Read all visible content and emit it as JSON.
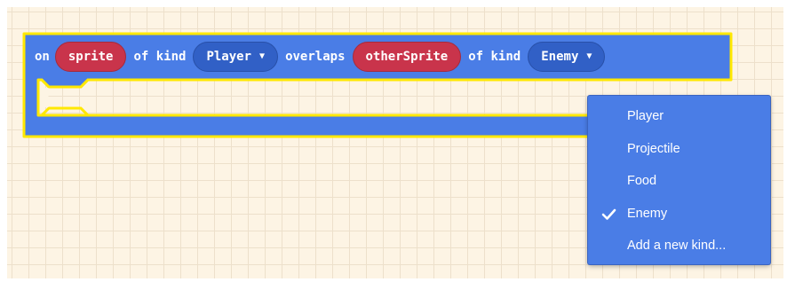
{
  "block": {
    "prefix": "on",
    "sprite_var": "sprite",
    "of_kind_1": "of kind",
    "kind_1": "Player",
    "overlaps": "overlaps",
    "other_var": "otherSprite",
    "of_kind_2": "of kind",
    "kind_2": "Enemy",
    "dropdown_arrow": "▼"
  },
  "colors": {
    "block": "#4a7de6",
    "block_border": "#ffe800",
    "variable": "#c9344b",
    "dropdown_field": "#3160c6",
    "menu": "#4a7de6"
  },
  "dropdown_menu": {
    "items": [
      {
        "label": "Player",
        "checked": false
      },
      {
        "label": "Projectile",
        "checked": false
      },
      {
        "label": "Food",
        "checked": false
      },
      {
        "label": "Enemy",
        "checked": true
      },
      {
        "label": "Add a new kind...",
        "checked": false
      }
    ],
    "checked_icon": "check-icon"
  }
}
